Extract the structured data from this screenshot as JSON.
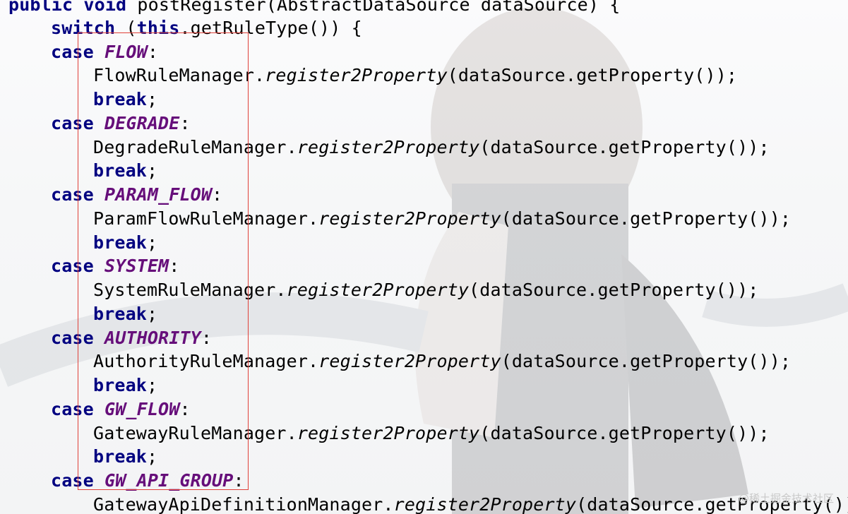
{
  "editor": {
    "lines": [
      [
        "public",
        " ",
        "void",
        " postRegister(AbstractDataSource dataSource) {"
      ],
      [
        "switch",
        " (",
        "this",
        ".getRuleType()) {"
      ],
      [
        "case",
        " ",
        "FLOW",
        ":"
      ],
      [
        "FlowRuleManager.",
        "register2Property",
        "(dataSource.getProperty());"
      ],
      [
        "break",
        ";"
      ],
      [
        "case",
        " ",
        "DEGRADE",
        ":"
      ],
      [
        "DegradeRuleManager.",
        "register2Property",
        "(dataSource.getProperty());"
      ],
      [
        "break",
        ";"
      ],
      [
        "case",
        " ",
        "PARAM_FLOW",
        ":"
      ],
      [
        "ParamFlowRuleManager.",
        "register2Property",
        "(dataSource.getProperty());"
      ],
      [
        "break",
        ";"
      ],
      [
        "case",
        " ",
        "SYSTEM",
        ":"
      ],
      [
        "SystemRuleManager.",
        "register2Property",
        "(dataSource.getProperty());"
      ],
      [
        "break",
        ";"
      ],
      [
        "case",
        " ",
        "AUTHORITY",
        ":"
      ],
      [
        "AuthorityRuleManager.",
        "register2Property",
        "(dataSource.getProperty());"
      ],
      [
        "break",
        ";"
      ],
      [
        "case",
        " ",
        "GW_FLOW",
        ":"
      ],
      [
        "GatewayRuleManager.",
        "register2Property",
        "(dataSource.getProperty());"
      ],
      [
        "break",
        ";"
      ],
      [
        "case",
        " ",
        "GW_API_GROUP",
        ":"
      ],
      [
        "GatewayApiDefinitionManager.",
        "register2Property",
        "(dataSource.getProperty())"
      ]
    ]
  },
  "watermark": "@稀土掘金技术社区",
  "colors": {
    "keyword": "#000080",
    "constant": "#660e7a",
    "highlight_box": "#e0413a"
  }
}
